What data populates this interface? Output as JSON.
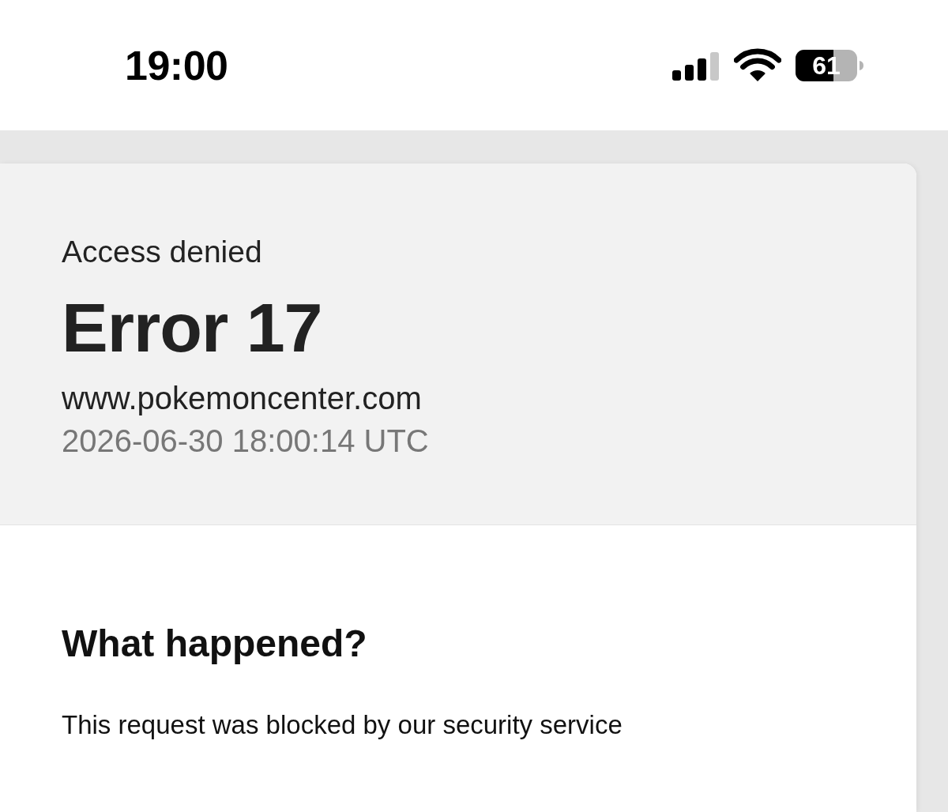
{
  "status_bar": {
    "time": "19:00",
    "battery": "61"
  },
  "error_header": {
    "label": "Access denied",
    "title": "Error 17",
    "host": "www.pokemoncenter.com",
    "timestamp": "2026-06-30 18:00:14 UTC"
  },
  "section": {
    "heading": "What happened?",
    "body": "This request was blocked by our security service"
  }
}
